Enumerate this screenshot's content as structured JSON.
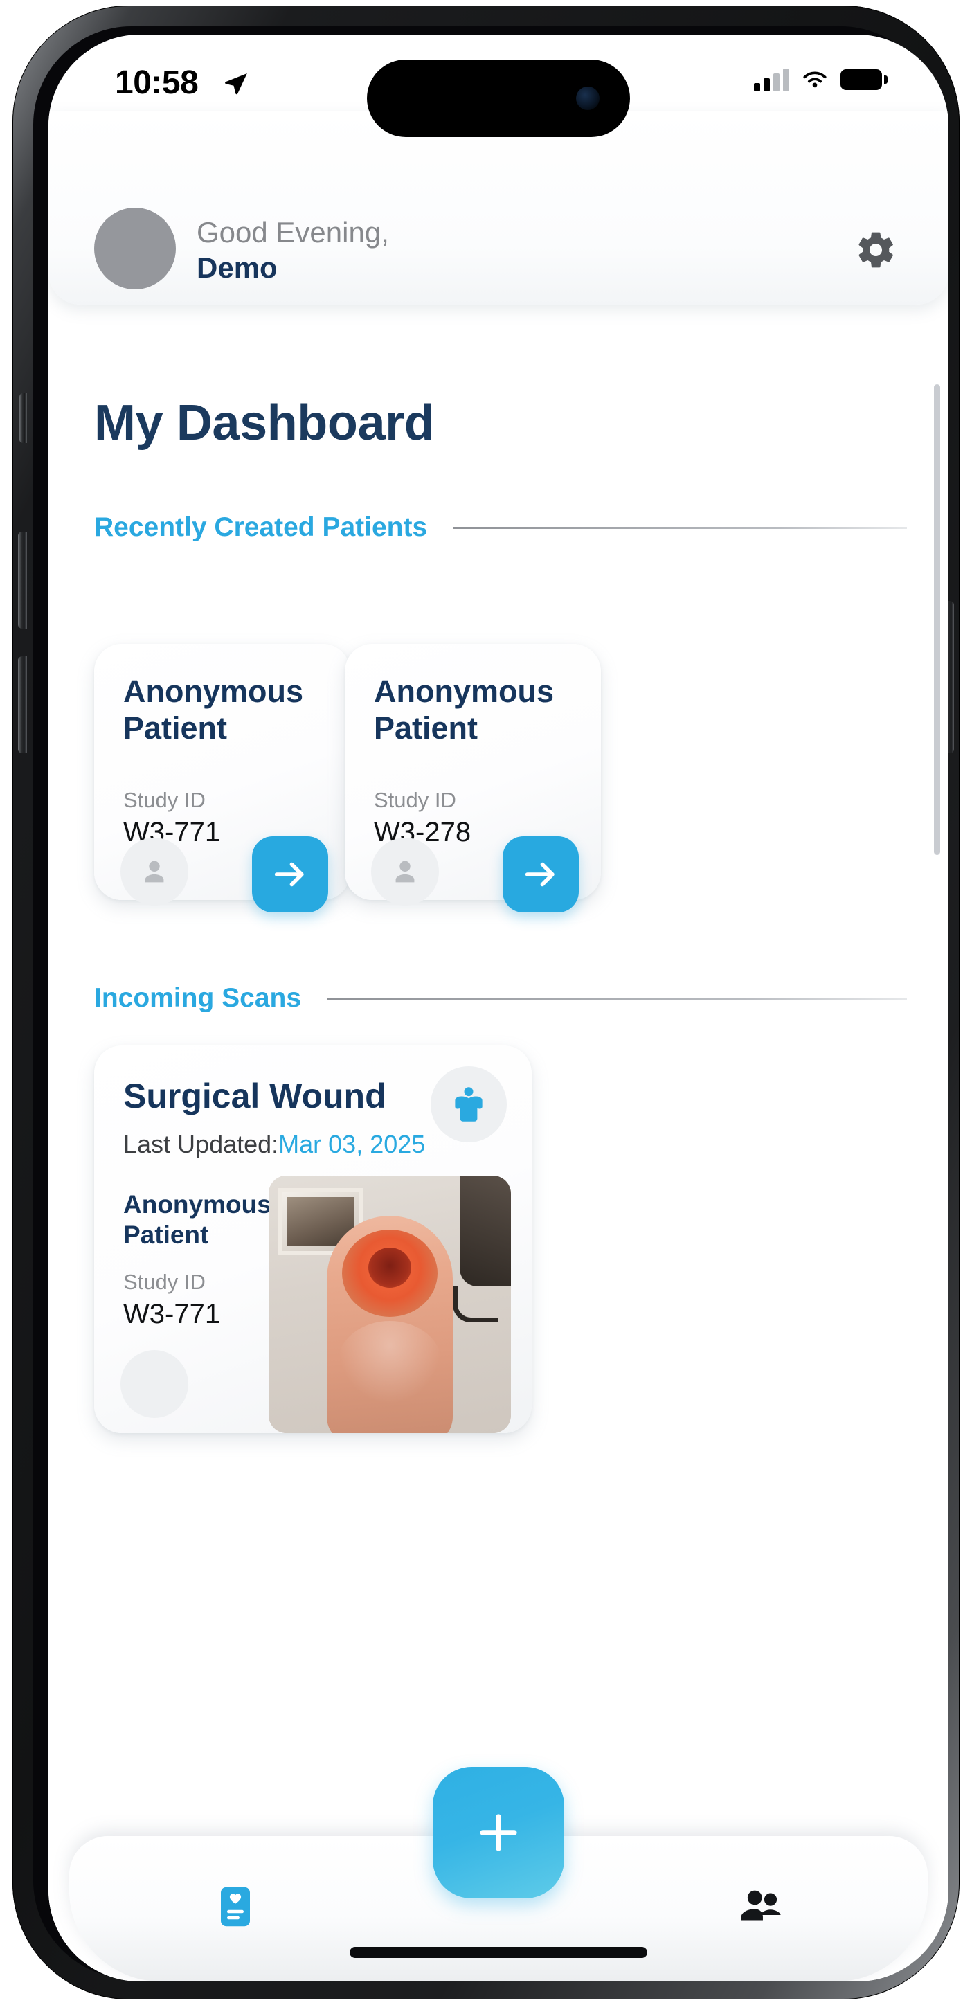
{
  "status_bar": {
    "time": "10:58",
    "location_icon": "location-arrow-icon",
    "signal_icon": "cellular-signal-icon",
    "wifi_icon": "wifi-icon",
    "battery_icon": "battery-full-icon"
  },
  "header": {
    "greeting": "Good Evening,",
    "user_name": "Demo",
    "avatar_name": "user-avatar",
    "settings_icon": "gear-icon"
  },
  "page": {
    "title": "My Dashboard"
  },
  "sections": {
    "recent_patients": {
      "label": "Recently Created Patients",
      "cards": [
        {
          "name": "Anonymous Patient",
          "study_id_label": "Study ID",
          "study_id": "W3-771",
          "avatar_icon": "person-icon",
          "action_icon": "arrow-right-icon"
        },
        {
          "name": "Anonymous Patient",
          "study_id_label": "Study ID",
          "study_id": "W3-278",
          "avatar_icon": "person-icon",
          "action_icon": "arrow-right-icon"
        }
      ]
    },
    "incoming_scans": {
      "label": "Incoming Scans",
      "card": {
        "title": "Surgical Wound",
        "updated_label": "Last Updated:",
        "updated_date": "Mar 03, 2025",
        "patient_name": "Anonymous Patient",
        "study_id_label": "Study ID",
        "study_id": "W3-771",
        "body_icon": "torso-body-icon",
        "avatar_icon": "person-icon",
        "photo_alt": "wound-scan-photo"
      }
    }
  },
  "tabbar": {
    "records_icon": "medical-record-card-icon",
    "add_icon": "plus-icon",
    "people_icon": "people-icon"
  },
  "colors": {
    "accent_blue": "#29A9E0",
    "navy": "#16355C",
    "muted_gray": "#8C8E92",
    "surface": "#FFFFFF"
  }
}
